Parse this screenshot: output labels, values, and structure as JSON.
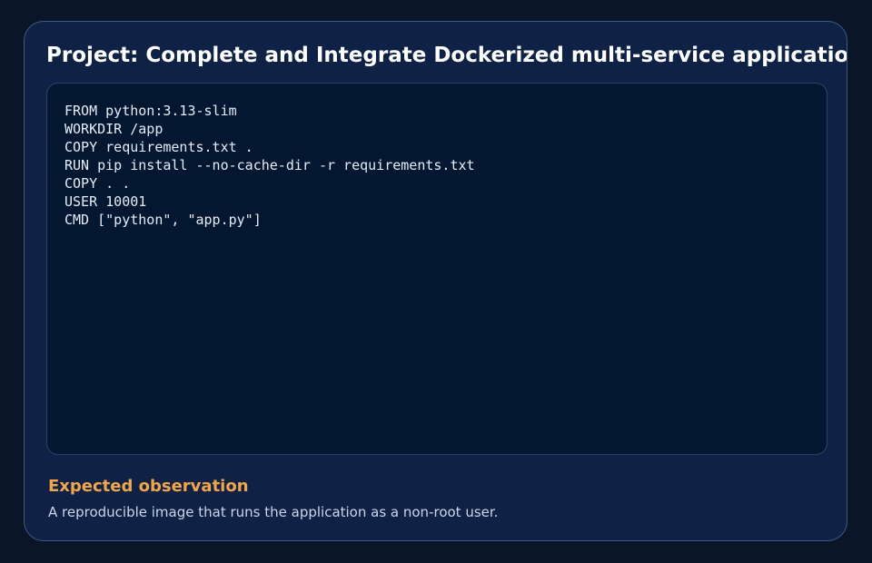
{
  "card": {
    "title": "Project: Complete and Integrate Dockerized multi-service application"
  },
  "code": {
    "lines": [
      "FROM python:3.13-slim",
      "WORKDIR /app",
      "COPY requirements.txt .",
      "RUN pip install --no-cache-dir -r requirements.txt",
      "COPY . .",
      "USER 10001",
      "CMD [\"python\", \"app.py\"]"
    ]
  },
  "observation": {
    "heading": "Expected observation",
    "text": "A reproducible image that runs the application as a non-root user."
  },
  "colors": {
    "background": "#0a1628",
    "card": "#0f2246",
    "code_panel": "#031730",
    "accent": "#f2a64b",
    "title": "#ffffff"
  }
}
